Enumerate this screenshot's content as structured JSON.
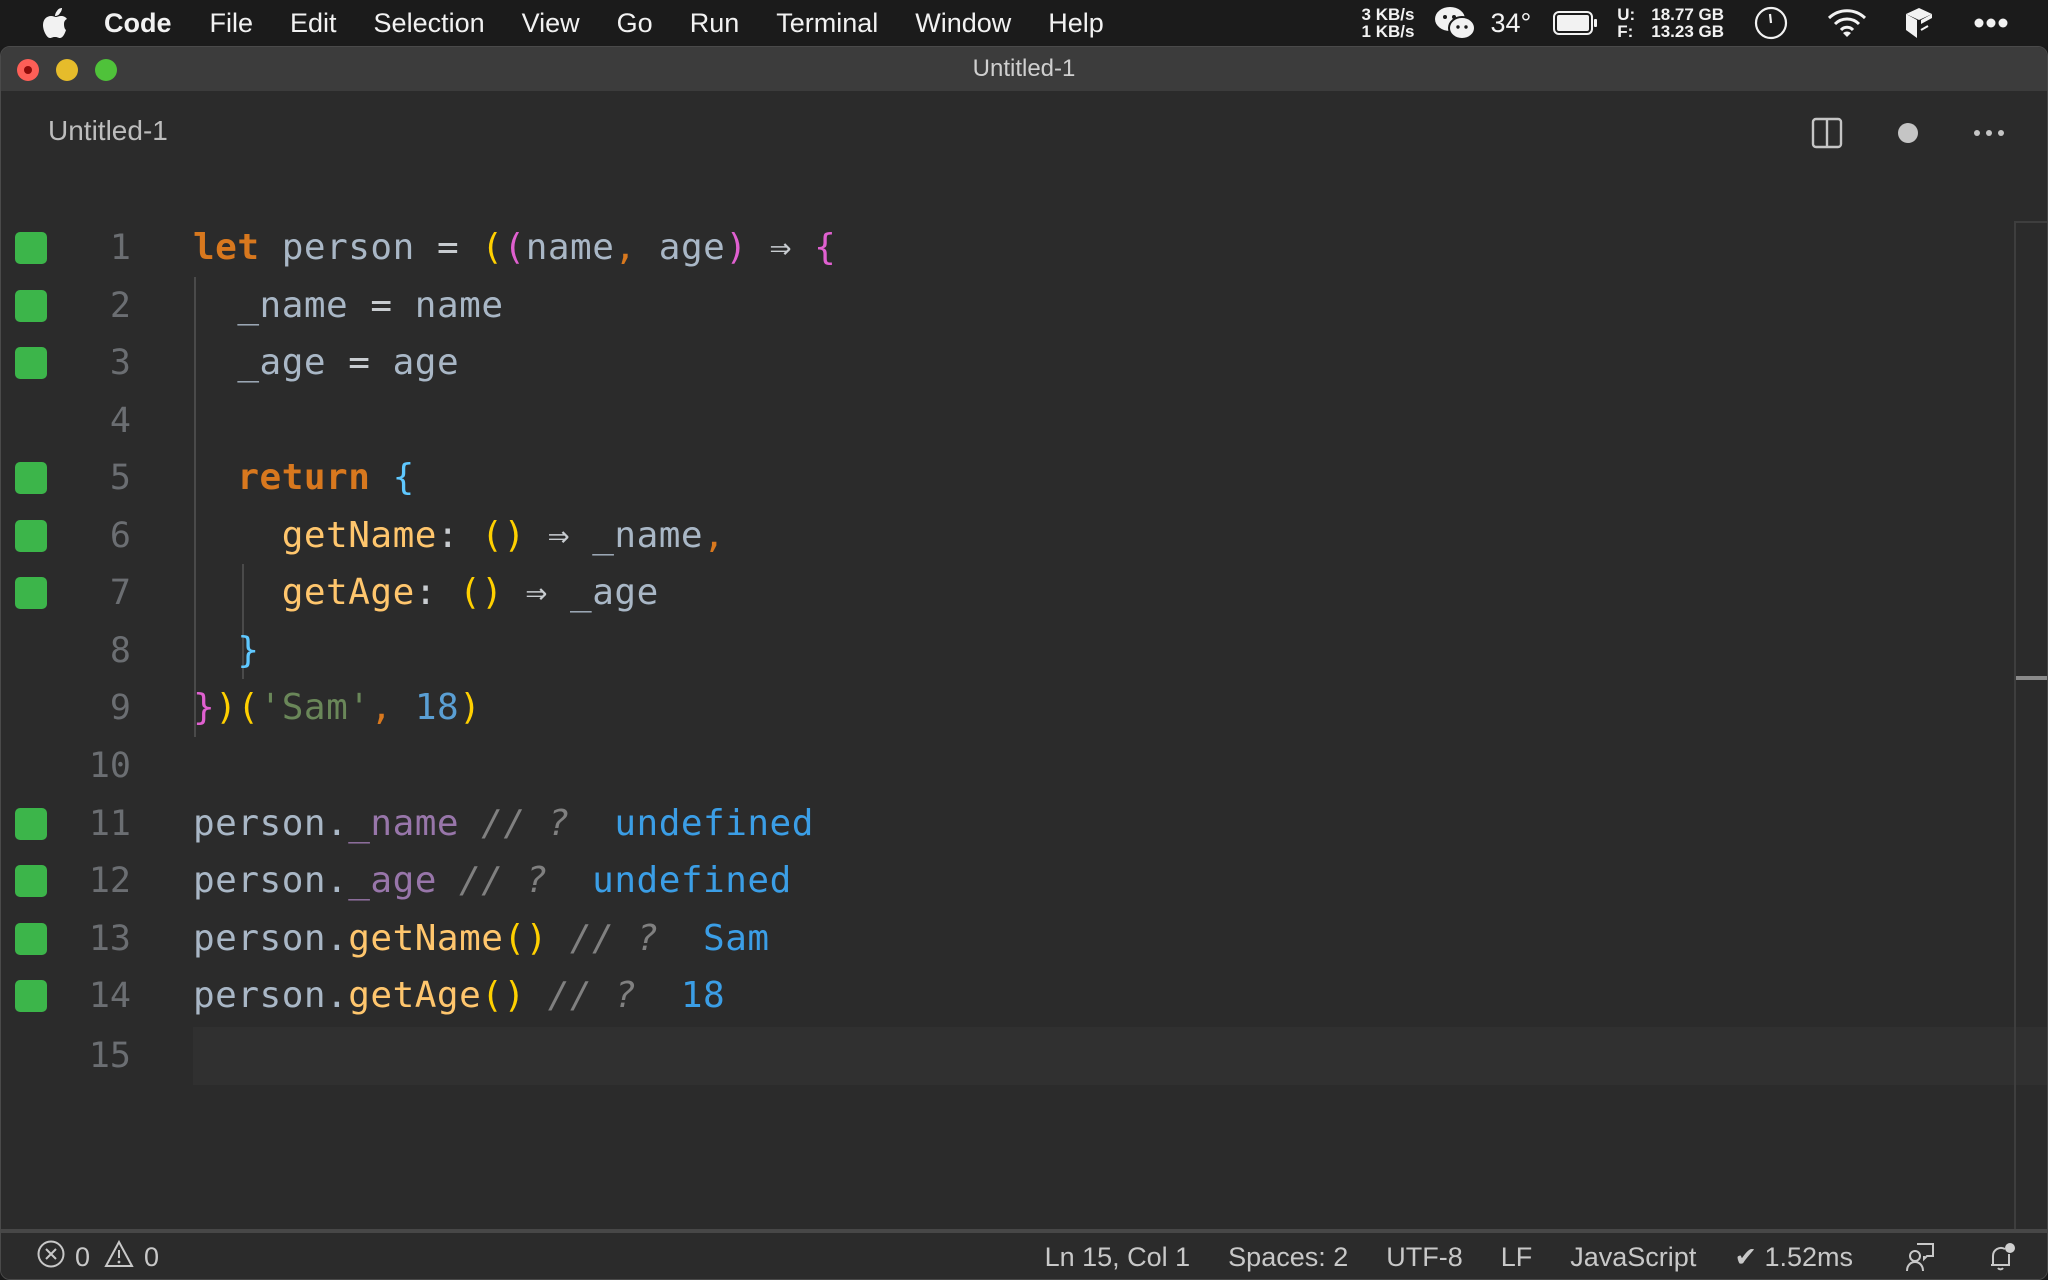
{
  "menubar": {
    "app_name": "Code",
    "items": [
      "File",
      "Edit",
      "Selection",
      "View",
      "Go",
      "Run",
      "Terminal",
      "Window",
      "Help"
    ],
    "network": {
      "up": "3 KB/s",
      "down": "1 KB/s"
    },
    "temperature": "34°",
    "disk": {
      "used_label": "U:",
      "used_value": "18.77 GB",
      "free_label": "F:",
      "free_value": "13.23 GB"
    }
  },
  "window": {
    "title": "Untitled-1"
  },
  "tab": {
    "label": "Untitled-1",
    "dirty": true
  },
  "editor": {
    "current_line": 15,
    "lines": [
      {
        "number": "1",
        "covered": true
      },
      {
        "number": "2",
        "covered": true
      },
      {
        "number": "3",
        "covered": true
      },
      {
        "number": "4",
        "covered": false
      },
      {
        "number": "5",
        "covered": true
      },
      {
        "number": "6",
        "covered": true
      },
      {
        "number": "7",
        "covered": true
      },
      {
        "number": "8",
        "covered": false
      },
      {
        "number": "9",
        "covered": false
      },
      {
        "number": "10",
        "covered": false
      },
      {
        "number": "11",
        "covered": true
      },
      {
        "number": "12",
        "covered": true
      },
      {
        "number": "13",
        "covered": true
      },
      {
        "number": "14",
        "covered": true
      },
      {
        "number": "15",
        "covered": false
      }
    ],
    "code": {
      "l1": {
        "kw": "let",
        "var": "person",
        "eq": "=",
        "p1": "(",
        "p2": "(",
        "a1": "name",
        "c1": ",",
        "a2": "age",
        "p3": ")",
        "arrow": "⇒",
        "brace": "{"
      },
      "l2": {
        "lhs": "_name",
        "eq": "=",
        "rhs": "name"
      },
      "l3": {
        "lhs": "_age",
        "eq": "=",
        "rhs": "age"
      },
      "l5": {
        "kw": "return",
        "brace": "{"
      },
      "l6": {
        "fn": "getName",
        "colon": ":",
        "parens": "()",
        "arrow": "⇒",
        "val": "_name",
        "comma": ","
      },
      "l7": {
        "fn": "getAge",
        "colon": ":",
        "parens": "()",
        "arrow": "⇒",
        "val": "_age"
      },
      "l8": {
        "brace": "}"
      },
      "l9": {
        "brace": "}",
        "p1": ")",
        "p2": "(",
        "str": "'Sam'",
        "comma": ",",
        "num": "18",
        "p3": ")"
      },
      "l11": {
        "obj": "person.",
        "prop": "_name",
        "comment": "// ?",
        "result": "undefined"
      },
      "l12": {
        "obj": "person.",
        "prop": "_age",
        "comment": "// ?",
        "result": "undefined"
      },
      "l13": {
        "obj": "person.",
        "fn": "getName",
        "parens": "()",
        "comment": "// ?",
        "result": "Sam"
      },
      "l14": {
        "obj": "person.",
        "fn": "getAge",
        "parens": "()",
        "comment": "// ?",
        "result": "18"
      }
    }
  },
  "statusbar": {
    "errors": "0",
    "warnings": "0",
    "position": "Ln 15, Col 1",
    "indent": "Spaces: 2",
    "encoding": "UTF-8",
    "eol": "LF",
    "language": "JavaScript",
    "quokka": "✔ 1.52ms"
  },
  "colors": {
    "coverage_mark": "#3cb54a",
    "keyword": "#d8781e",
    "function": "#ffc66d",
    "string": "#6a8759",
    "number": "#5a9fd4",
    "result": "#3b9ee6"
  }
}
